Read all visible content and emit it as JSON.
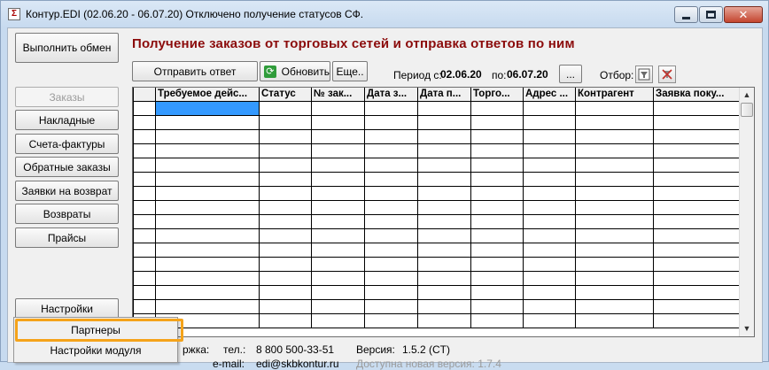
{
  "window": {
    "title": "Контур.EDI (02.06.20 - 06.07.20) Отключено получение статусов СФ.",
    "icon": "app-icon"
  },
  "sidebar": {
    "run_exchange": "Выполнить обмен",
    "items": [
      {
        "label": "Заказы",
        "disabled": true
      },
      {
        "label": "Накладные"
      },
      {
        "label": "Счета-фактуры"
      },
      {
        "label": "Обратные заказы"
      },
      {
        "label": "Заявки на возврат"
      },
      {
        "label": "Возвраты"
      },
      {
        "label": "Прайсы"
      }
    ],
    "settings": "Настройки"
  },
  "main": {
    "heading": "Получение заказов от торговых сетей и отправка ответов по ним",
    "toolbar": {
      "send_reply": "Отправить ответ",
      "refresh": "Обновить",
      "more": "Еще..",
      "period_from_label": "Период с:",
      "period_from": "02.06.20",
      "period_to_label": "по:",
      "period_to": "06.07.20",
      "period_picker": "...",
      "filter_label": "Отбор:"
    },
    "grid": {
      "columns": [
        "",
        "Требуемое дейс...",
        "Статус",
        "№ зак...",
        "Дата з...",
        "Дата п...",
        "Торго...",
        "Адрес ...",
        "Контрагент",
        "Заявка поку..."
      ],
      "row_count": 16
    }
  },
  "footer": {
    "support_label": "ржка:",
    "phone_label": "тел.:",
    "phone": "8 800 500-33-51",
    "email_label": "e-mail:",
    "email": "edi@skbkontur.ru",
    "version_label": "Версия:",
    "version": "1.5.2 (CT)",
    "new_version": "Доступна новая версия: 1.7.4"
  },
  "context_menu": {
    "items": [
      "Партнеры",
      "Настройки модуля"
    ],
    "highlight_color": "#f5a31a"
  },
  "colors": {
    "heading": "#8b0b0b",
    "selection": "#3399ff"
  }
}
